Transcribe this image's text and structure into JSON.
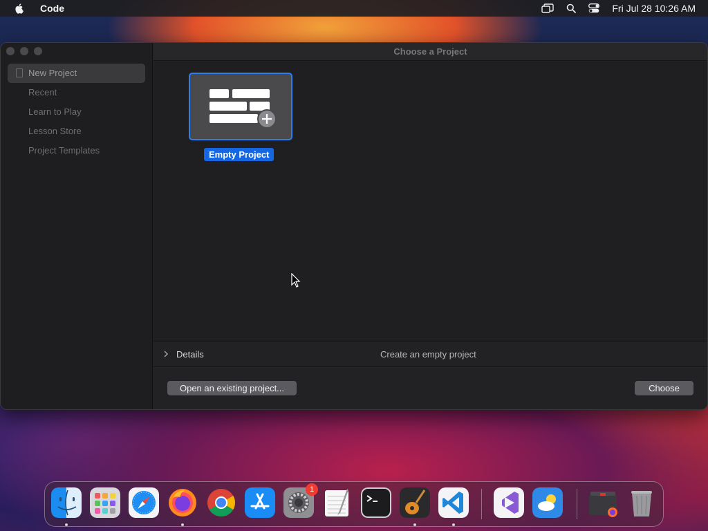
{
  "menubar": {
    "app_name": "Code",
    "clock": "Fri Jul 28  10:26 AM"
  },
  "window": {
    "title": "Choose a Project",
    "sidebar": {
      "items": [
        {
          "label": "New Project",
          "selected": true
        },
        {
          "label": "Recent"
        },
        {
          "label": "Learn to Play"
        },
        {
          "label": "Lesson Store"
        },
        {
          "label": "Project Templates"
        }
      ]
    },
    "project": {
      "label": "Empty Project"
    },
    "details": {
      "label": "Details",
      "description": "Create an empty project"
    },
    "buttons": {
      "open_existing": "Open an existing project...",
      "choose": "Choose"
    }
  },
  "dock": {
    "apps": [
      {
        "name": "finder-icon"
      },
      {
        "name": "launchpad-icon"
      },
      {
        "name": "safari-icon"
      },
      {
        "name": "firefox-icon"
      },
      {
        "name": "chrome-icon"
      },
      {
        "name": "app-store-icon"
      },
      {
        "name": "system-settings-icon",
        "badge": "1"
      },
      {
        "name": "textedit-icon"
      },
      {
        "name": "terminal-icon"
      },
      {
        "name": "garageband-icon"
      },
      {
        "name": "vscode-icon"
      },
      {
        "name": "visual-studio-icon"
      },
      {
        "name": "weather-icon"
      },
      {
        "name": "firefox-downloads-stack-icon"
      },
      {
        "name": "trash-icon"
      }
    ]
  },
  "colors": {
    "accent": "#1466e3",
    "selection_border": "#2c7ef0"
  }
}
